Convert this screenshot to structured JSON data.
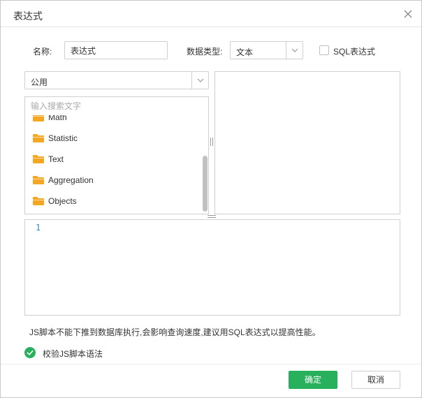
{
  "dialog": {
    "title": "表达式"
  },
  "form": {
    "name_label": "名称:",
    "name_value": "表达式",
    "datatype_label": "数据类型:",
    "datatype_value": "文本",
    "sql_checkbox_label": "SQL表达式",
    "sql_checked": false
  },
  "function_panel": {
    "category_value": "公用",
    "search_placeholder": "输入搜索文字",
    "items": [
      {
        "label": "Math",
        "icon": "folder-icon"
      },
      {
        "label": "Statistic",
        "icon": "folder-icon"
      },
      {
        "label": "Text",
        "icon": "folder-icon"
      },
      {
        "label": "Aggregation",
        "icon": "folder-icon"
      },
      {
        "label": "Objects",
        "icon": "folder-icon"
      }
    ]
  },
  "editor": {
    "line_number": "1"
  },
  "note": "JS脚本不能下推到数据库执行,会影响查询速度,建议用SQL表达式以提高性能。",
  "validate_label": "校验JS脚本语法",
  "buttons": {
    "ok": "确定",
    "cancel": "取消"
  },
  "colors": {
    "primary": "#29b05c",
    "folder": "#f5a623"
  }
}
